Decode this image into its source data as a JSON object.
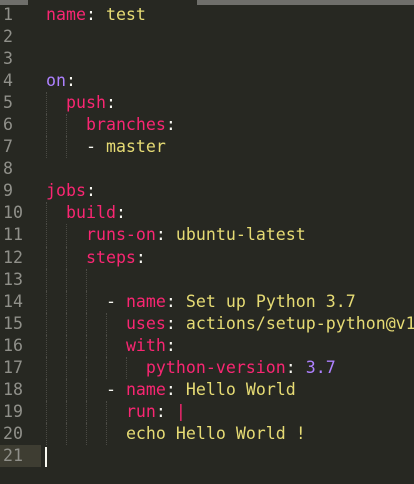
{
  "editor": {
    "colors": {
      "background": "#272822",
      "key": "#f92672",
      "string": "#e6db74",
      "constant": "#ae81ff",
      "punct": "#f8f8f2",
      "gutter": "#90908a"
    },
    "current_line": 21,
    "lines": [
      [
        [
          "name",
          "key"
        ],
        [
          ": ",
          "punct"
        ],
        [
          "test",
          "str"
        ]
      ],
      [],
      [],
      [
        [
          "on",
          "const"
        ],
        [
          ":",
          "punct"
        ]
      ],
      [
        [
          "  ",
          "punct"
        ],
        [
          "push",
          "key"
        ],
        [
          ":",
          "punct"
        ]
      ],
      [
        [
          "    ",
          "punct"
        ],
        [
          "branches",
          "key"
        ],
        [
          ":",
          "punct"
        ]
      ],
      [
        [
          "    ",
          "punct"
        ],
        [
          "- ",
          "punct"
        ],
        [
          "master",
          "str"
        ]
      ],
      [],
      [
        [
          "jobs",
          "key"
        ],
        [
          ":",
          "punct"
        ]
      ],
      [
        [
          "  ",
          "punct"
        ],
        [
          "build",
          "key"
        ],
        [
          ":",
          "punct"
        ]
      ],
      [
        [
          "    ",
          "punct"
        ],
        [
          "runs-on",
          "key"
        ],
        [
          ": ",
          "punct"
        ],
        [
          "ubuntu-latest",
          "str"
        ]
      ],
      [
        [
          "    ",
          "punct"
        ],
        [
          "steps",
          "key"
        ],
        [
          ":",
          "punct"
        ]
      ],
      [],
      [
        [
          "      ",
          "punct"
        ],
        [
          "- ",
          "punct"
        ],
        [
          "name",
          "key"
        ],
        [
          ": ",
          "punct"
        ],
        [
          "Set up Python 3.7",
          "str"
        ]
      ],
      [
        [
          "        ",
          "punct"
        ],
        [
          "uses",
          "key"
        ],
        [
          ": ",
          "punct"
        ],
        [
          "actions/setup-python@v1",
          "str"
        ]
      ],
      [
        [
          "        ",
          "punct"
        ],
        [
          "with",
          "key"
        ],
        [
          ":",
          "punct"
        ]
      ],
      [
        [
          "          ",
          "punct"
        ],
        [
          "python-version",
          "key"
        ],
        [
          ": ",
          "punct"
        ],
        [
          "3.7",
          "const"
        ]
      ],
      [
        [
          "      ",
          "punct"
        ],
        [
          "- ",
          "punct"
        ],
        [
          "name",
          "key"
        ],
        [
          ": ",
          "punct"
        ],
        [
          "Hello World",
          "str"
        ]
      ],
      [
        [
          "        ",
          "punct"
        ],
        [
          "run",
          "key"
        ],
        [
          ": ",
          "punct"
        ],
        [
          "|",
          "pipe"
        ]
      ],
      [
        [
          "        ",
          "punct"
        ],
        [
          "echo Hello World !",
          "str"
        ]
      ],
      []
    ]
  }
}
